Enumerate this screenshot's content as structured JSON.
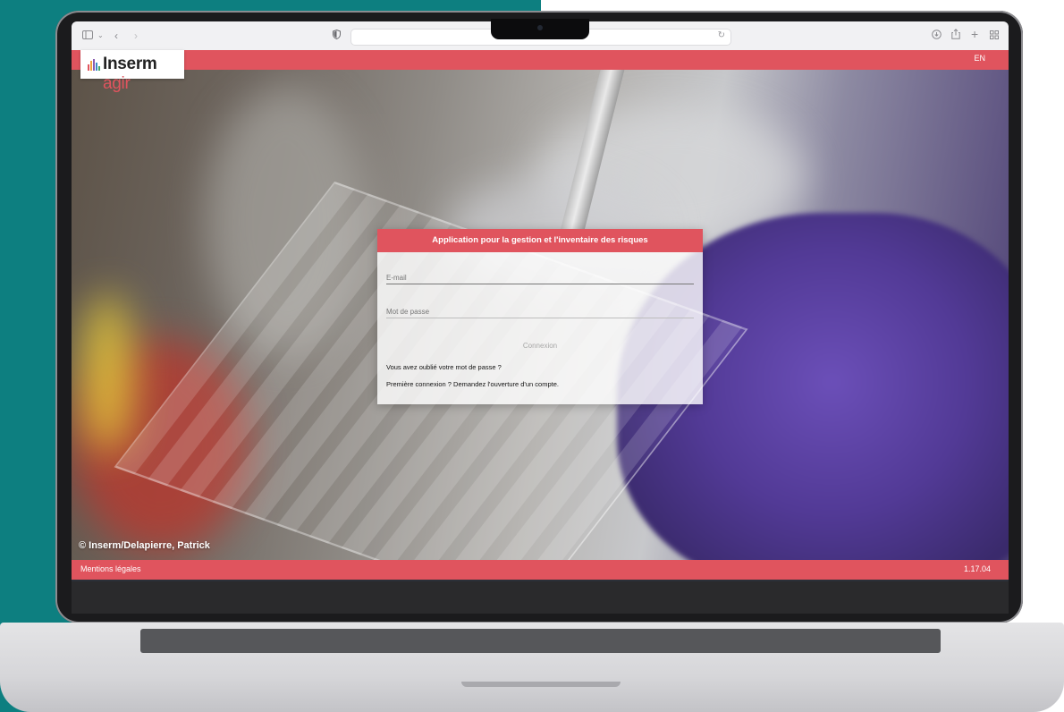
{
  "browser": {
    "icons": [
      "sidebar-icon",
      "chevron-down-icon",
      "back-icon",
      "forward-icon",
      "shield-icon",
      "reload-icon",
      "download-icon",
      "share-icon",
      "new-tab-icon",
      "tab-overview-icon"
    ]
  },
  "header": {
    "logo_brand": "Inserm",
    "logo_suffix": "agir",
    "language_link": "EN",
    "accent_color": "#e0545e"
  },
  "login": {
    "title": "Application pour la gestion et l'inventaire des risques",
    "email_placeholder": "E-mail",
    "password_placeholder": "Mot de passe",
    "submit_label": "Connexion",
    "forgot_password": "Vous avez oublié votre mot de passe ?",
    "first_login": "Première connexion ? Demandez l'ouverture d'un compte."
  },
  "photo_credit": "© Inserm/Delapierre, Patrick",
  "footer": {
    "legal_link": "Mentions légales",
    "version": "1.17.04"
  }
}
